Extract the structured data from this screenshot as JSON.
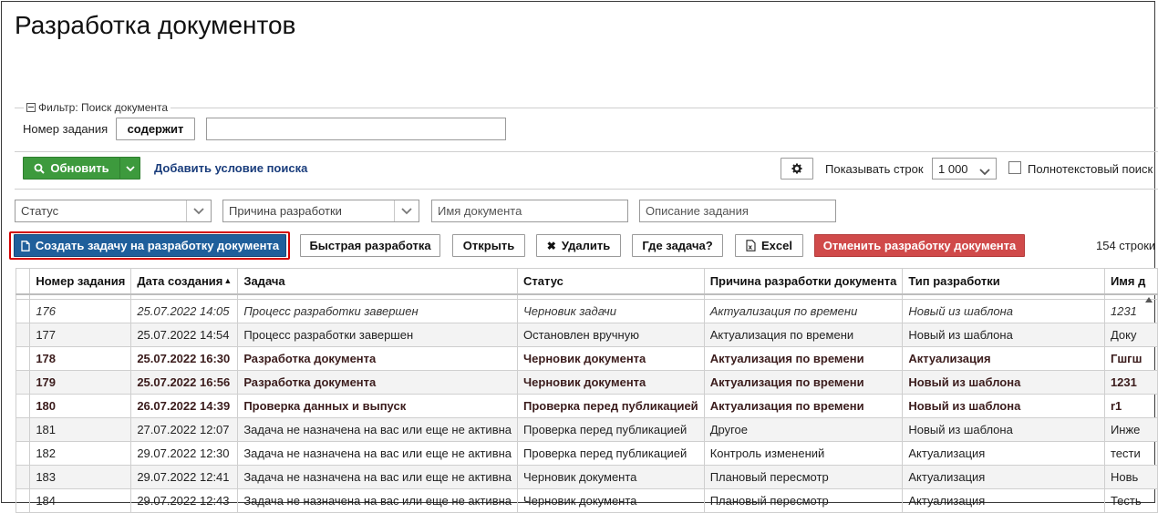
{
  "page_title": "Разработка документов",
  "filter": {
    "legend": "Фильтр: Поиск документа",
    "task_number_label": "Номер задания",
    "operator_button": "содержит",
    "task_number_value": ""
  },
  "toolbar": {
    "refresh_label": "Обновить",
    "add_condition_label": "Добавить условие поиска",
    "rows_label": "Показывать строк",
    "rows_value": "1 000",
    "fulltext_label": "Полнотекстовый поиск"
  },
  "filters_row": {
    "status_placeholder": "Статус",
    "reason_placeholder": "Причина разработки",
    "doc_name_placeholder": "Имя документа",
    "task_desc_placeholder": "Описание задания"
  },
  "actions": {
    "create_task": "Создать задачу на разработку документа",
    "quick_dev": "Быстрая разработка",
    "open": "Открыть",
    "delete": "Удалить",
    "where_task": "Где задача?",
    "excel": "Excel",
    "cancel_dev": "Отменить разработку документа",
    "row_count": "154 строки"
  },
  "table": {
    "columns": [
      "Номер задания",
      "Дата создания",
      "Задача",
      "Статус",
      "Причина разработки документа",
      "Тип разработки",
      "Имя д"
    ],
    "rows": [
      {
        "style": "italic",
        "cells": [
          "176",
          "25.07.2022 14:05",
          "Процесс разработки завершен",
          "Черновик задачи",
          "Актуализация по времени",
          "Новый из шаблона",
          "1231"
        ]
      },
      {
        "style": "normal",
        "cells": [
          "177",
          "25.07.2022 14:54",
          "Процесс разработки завершен",
          "Остановлен вручную",
          "Актуализация по времени",
          "Новый из шаблона",
          "Доку"
        ]
      },
      {
        "style": "bold",
        "cells": [
          "178",
          "25.07.2022 16:30",
          "Разработка документа",
          "Черновик документа",
          "Актуализация по времени",
          "Актуализация",
          "Гшгш"
        ]
      },
      {
        "style": "bold",
        "cells": [
          "179",
          "25.07.2022 16:56",
          "Разработка документа",
          "Черновик документа",
          "Актуализация по времени",
          "Новый из шаблона",
          "1231"
        ]
      },
      {
        "style": "bold",
        "cells": [
          "180",
          "26.07.2022 14:39",
          "Проверка данных и выпуск",
          "Проверка перед публикацией",
          "Актуализация по времени",
          "Новый из шаблона",
          "r1"
        ]
      },
      {
        "style": "normal",
        "cells": [
          "181",
          "27.07.2022 12:07",
          "Задача не назначена на вас или еще не активна",
          "Проверка перед публикацией",
          "Другое",
          "Новый из шаблона",
          "Инже"
        ]
      },
      {
        "style": "normal",
        "cells": [
          "182",
          "29.07.2022 12:30",
          "Задача не назначена на вас или еще не активна",
          "Проверка перед публикацией",
          "Контроль изменений",
          "Актуализация",
          "тести"
        ]
      },
      {
        "style": "normal",
        "cells": [
          "183",
          "29.07.2022 12:41",
          "Задача не назначена на вас или еще не активна",
          "Черновик документа",
          "Плановый пересмотр",
          "Актуализация",
          "Новь"
        ]
      },
      {
        "style": "normal",
        "cells": [
          "184",
          "29.07.2022 12:43",
          "Задача не назначена на вас или еще не активна",
          "Черновик документа",
          "Плановый пересмотр",
          "Актуализация",
          "Тесть"
        ]
      }
    ]
  }
}
